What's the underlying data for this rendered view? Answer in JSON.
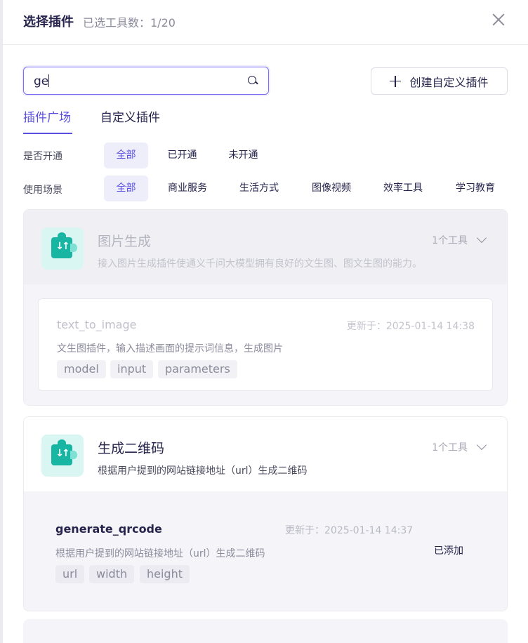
{
  "header": {
    "title": "选择插件",
    "count": "已选工具数：1/20"
  },
  "search": {
    "value": "ge"
  },
  "create_button": {
    "label": "创建自定义插件"
  },
  "tabs": [
    {
      "label": "插件广场",
      "active": true
    },
    {
      "label": "自定义插件",
      "active": false
    }
  ],
  "filters": {
    "status": {
      "label": "是否开通",
      "options": [
        "全部",
        "已开通",
        "未开通"
      ],
      "selected": "全部"
    },
    "scene": {
      "label": "使用场景",
      "options": [
        "全部",
        "商业服务",
        "生活方式",
        "图像视频",
        "效率工具",
        "学习教育"
      ],
      "selected": "全部"
    }
  },
  "plugins": [
    {
      "title": "图片生成",
      "description": "接入图片生成插件使通义千问大模型拥有良好的文生图、图文生图的能力。",
      "count": "1个工具",
      "icon": "puzzle-transfer-icon",
      "tool": {
        "name": "text_to_image",
        "updated": "更新于：2025-01-14 14:38",
        "description": "文生图插件，输入描述画面的提示词信息，生成图片",
        "params": [
          "model",
          "input",
          "parameters"
        ]
      }
    },
    {
      "title": "生成二维码",
      "description": "根据用户提到的网站链接地址（url）生成二维码",
      "count": "1个工具",
      "icon": "puzzle-transfer-icon",
      "tool": {
        "name": "generate_qrcode",
        "updated": "更新于：2025-01-14 14:37",
        "description": "根据用户提到的网站链接地址（url）生成二维码",
        "params": [
          "url",
          "width",
          "height"
        ],
        "status": "已添加"
      }
    }
  ],
  "colors": {
    "accent": "#5a4fe0",
    "plugin_icon_bg": "#d9f6f3",
    "plugin_icon_fg": "#17b5a2"
  }
}
